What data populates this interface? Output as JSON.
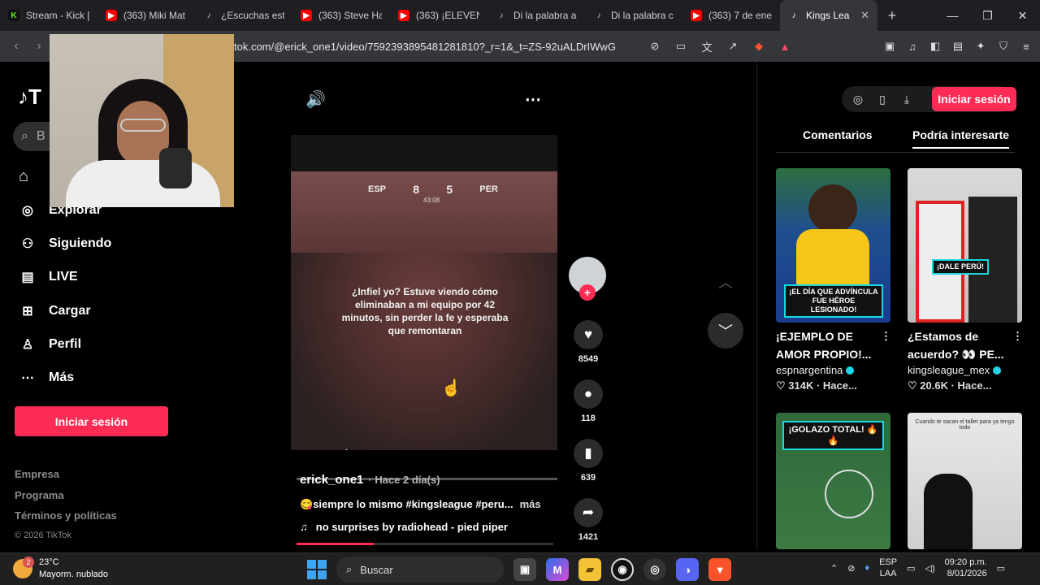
{
  "browser": {
    "tabs": [
      {
        "title": "Stream - Kick [",
        "favicon": "K",
        "color": "#53fc18"
      },
      {
        "title": "(363) Miki Mat",
        "favicon": "▶",
        "color": "#ff0000"
      },
      {
        "title": "¿Escuchas esta",
        "favicon": "♪",
        "color": "#ffffff"
      },
      {
        "title": "(363) Steve Ha",
        "favicon": "▶",
        "color": "#ff0000"
      },
      {
        "title": "(363) ¡ELEVEN",
        "favicon": "▶",
        "color": "#ff0000"
      },
      {
        "title": "Di la palabra a",
        "favicon": "♪",
        "color": "#ffffff"
      },
      {
        "title": "Di la palabra c",
        "favicon": "♪",
        "color": "#ffffff"
      },
      {
        "title": "(363) 7 de ene",
        "favicon": "▶",
        "color": "#ff0000"
      },
      {
        "title": "Kings Lea",
        "favicon": "♪",
        "color": "#ffffff",
        "active": true
      }
    ],
    "url": "tok.com/@erick_one1/video/7592393895481281810?_r=1&_t=ZS-92uALDrIWwG"
  },
  "sidebar": {
    "logo": "T",
    "search_placeholder": "B",
    "items": [
      {
        "label": "Explorar",
        "icon": "compass-icon"
      },
      {
        "label": "Siguiendo",
        "icon": "following-icon"
      },
      {
        "label": "LIVE",
        "icon": "live-tv-icon"
      },
      {
        "label": "Cargar",
        "icon": "upload-icon"
      },
      {
        "label": "Perfil",
        "icon": "profile-icon"
      },
      {
        "label": "Más",
        "icon": "more-dots-icon"
      }
    ],
    "login_label": "Iniciar sesión",
    "footer": [
      "Empresa",
      "Programa",
      "Términos y políticas"
    ],
    "copyright": "© 2026 TikTok"
  },
  "video": {
    "score_left_team": "ESP",
    "score_left": "8",
    "score_right": "5",
    "score_right_team": "PER",
    "score_time": "43:08",
    "caption": "¿Infiel yo? Estuve viendo cómo eliminaban a mi equipo por 42 minutos, sin perder la fe y esperaba que remontaran",
    "speed_label": "x 1",
    "author": "erick_one1",
    "posted_ago": "· Hace 2 día(s)",
    "description": "😋siempre lo mismo #kingsleague #peru...",
    "more_label": "más",
    "music": "no surprises by radiohead - pied piper",
    "progress_fraction": 0.3
  },
  "actions": {
    "likes": "8549",
    "comments": "118",
    "saves": "639",
    "shares": "1421"
  },
  "right_panel": {
    "login_label": "Iniciar sesión",
    "tabs": [
      "Comentarios",
      "Podría interesarte"
    ],
    "cards": [
      {
        "title": "¡EJEMPLO DE AMOR PROPIO!...",
        "author": "espnargentina",
        "likes": "314K",
        "ago": "Hace...",
        "tag": "¡EL DÍA QUE ADVÍNCULA FUE HÉROE LESIONADO!"
      },
      {
        "title": "¿Estamos de acuerdo? 👀 PE...",
        "author": "kingsleague_mex",
        "likes": "20.6K",
        "ago": "Hace...",
        "tag": "¡DALE PERÚ!"
      },
      {
        "tag": "¡GOLAZO TOTAL! 🔥🔥"
      },
      {
        "tag": "Cuando te sacan el taller para ya tengo todo"
      }
    ]
  },
  "taskbar": {
    "temperature": "23°C",
    "weather_text": "Mayorm. nublado",
    "weather_badge": "2",
    "search_label": "Buscar",
    "lang_top": "ESP",
    "lang_bottom": "LAA",
    "time": "09:20 p.m.",
    "date": "8/01/2026"
  }
}
